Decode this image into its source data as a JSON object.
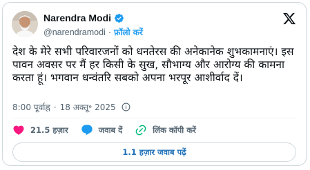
{
  "author": {
    "name": "Narendra Modi",
    "handle": "@narendramodi",
    "follow_label": "फ़ॉलो करें",
    "verified_icon": "verified-badge-icon",
    "verified_color": "#1d9bf0"
  },
  "tweet": {
    "text": "देश के मेरे सभी परिवारजनों को धनतेरस की अनेकानेक शुभकामनाएं। इस पावन अवसर पर मैं हर किसी के सुख, सौभाग्य और आरोग्य की कामना करता हूं। भगवान धन्वंतरि सबको अपना भरपूर आशीर्वाद दें।",
    "time": "8:00 पूर्वाह्न",
    "date": "18 अक्तू॰ 2025"
  },
  "actions": {
    "likes": "21.5 हज़ार",
    "reply_label": "जवाब दें",
    "copy_link_label": "लिंक कॉपी करें",
    "like_color": "#f91880",
    "reply_color": "#1d9bf0",
    "copy_color": "#00ba7c"
  },
  "replies_button": "1.1 हज़ार जवाब पढ़ें",
  "brand": {
    "logo": "x-logo-icon"
  }
}
